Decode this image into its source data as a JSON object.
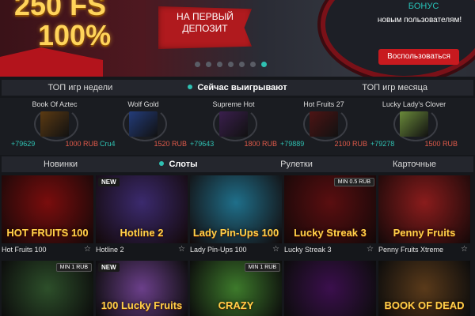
{
  "banner": {
    "promo_line1": "250 FS",
    "promo_line2": "100%",
    "ribbon_line1": "НА ПЕРВЫЙ",
    "ribbon_line2": "ДЕПОЗИТ",
    "bonus_title": "БОНУС",
    "bonus_subtitle": "новым пользователям!",
    "cta_label": "Воспользоваться",
    "slides": 7,
    "active_slide": 7,
    "accent": "#2fc1b2",
    "cta_color": "#c81a1f"
  },
  "winner_tabs": [
    {
      "label": "ТОП игр недели",
      "active": false
    },
    {
      "label": "Сейчас выигрывают",
      "active": true
    },
    {
      "label": "ТОП игр месяца",
      "active": false
    }
  ],
  "winners": [
    {
      "game": "Book Of Aztec",
      "user": "+79629",
      "amount": "1000 RUB",
      "thumb": "#5b3a12"
    },
    {
      "game": "Wolf Gold",
      "user": "Cru4",
      "amount": "1520 RUB",
      "thumb": "#233c7a"
    },
    {
      "game": "Supreme Hot",
      "user": "+79643",
      "amount": "1800 RUB",
      "thumb": "#3a1f4d"
    },
    {
      "game": "Hot Fruits 27",
      "user": "+79889",
      "amount": "2100 RUB",
      "thumb": "#4d1414"
    },
    {
      "game": "Lucky Lady's Clover",
      "user": "+79278",
      "amount": "1500 RUB",
      "thumb": "#6a8a3a"
    }
  ],
  "category_tabs": [
    {
      "label": "Новинки",
      "active": false
    },
    {
      "label": "Слоты",
      "active": true
    },
    {
      "label": "Рулетки",
      "active": false
    },
    {
      "label": "Карточные",
      "active": false
    }
  ],
  "games": [
    {
      "title": "Hot Fruits 100",
      "art": "HOT FRUITS 100",
      "new": false,
      "min": "",
      "bg": "#7a0d0d"
    },
    {
      "title": "Hotline 2",
      "art": "Hotline 2",
      "new": true,
      "min": "",
      "bg": "#3b2a6e"
    },
    {
      "title": "Lady Pin-Ups 100",
      "art": "Lady Pin-Ups 100",
      "new": false,
      "min": "",
      "bg": "#1f6f8a"
    },
    {
      "title": "Lucky Streak 3",
      "art": "Lucky Streak 3",
      "new": false,
      "min": "MIN 0.5 RUB",
      "bg": "#5a0e10"
    },
    {
      "title": "Penny Fruits Xtreme",
      "art": "Penny Fruits",
      "new": false,
      "min": "",
      "bg": "#8a1c1c"
    }
  ],
  "games_row2": [
    {
      "art": "",
      "new": false,
      "min": "MIN 1 RUB",
      "bg": "#2d4f2a"
    },
    {
      "art": "100 Lucky Fruits",
      "new": true,
      "min": "",
      "bg": "#6b3f8a"
    },
    {
      "art": "CRAZY",
      "new": false,
      "min": "MIN 1 RUB",
      "bg": "#3d7a2b"
    },
    {
      "art": "",
      "new": false,
      "min": "",
      "bg": "#3b0f4d"
    },
    {
      "art": "BOOK OF DEAD",
      "new": false,
      "min": "",
      "bg": "#5a3a1a"
    }
  ],
  "star_glyph": "☆"
}
